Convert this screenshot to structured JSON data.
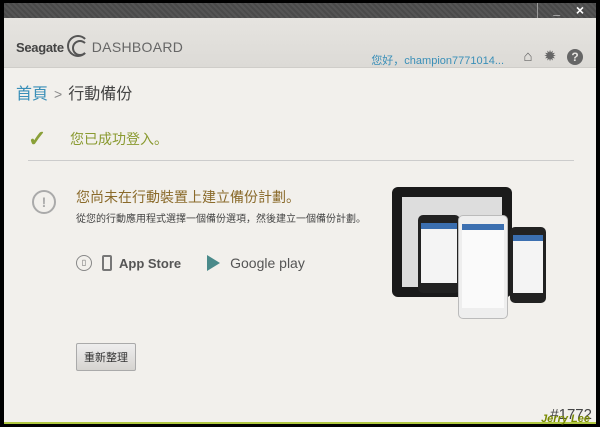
{
  "window": {
    "minimize_label": "_",
    "close_label": "×"
  },
  "header": {
    "brand": "Seagate",
    "product": "DASHBOARD",
    "user_greeting": "您好，champion7771014...",
    "icons": [
      "home-icon",
      "gear-icon",
      "help-icon"
    ]
  },
  "breadcrumb": {
    "home": "首頁",
    "separator": ">",
    "current": "行動備份"
  },
  "status": {
    "success_text": "您已成功登入。",
    "color": "#8aa038"
  },
  "notice": {
    "title": "您尚未在行動裝置上建立備份計劃。",
    "body": "從您的行動應用程式選擇一個備份選項，然後建立一個備份計劃。"
  },
  "stores": {
    "app_store": "App Store",
    "google_play": "Google play"
  },
  "actions": {
    "refresh_label": "重新整理"
  },
  "watermark": {
    "number": "#1772",
    "author": "Jerry Lee"
  }
}
